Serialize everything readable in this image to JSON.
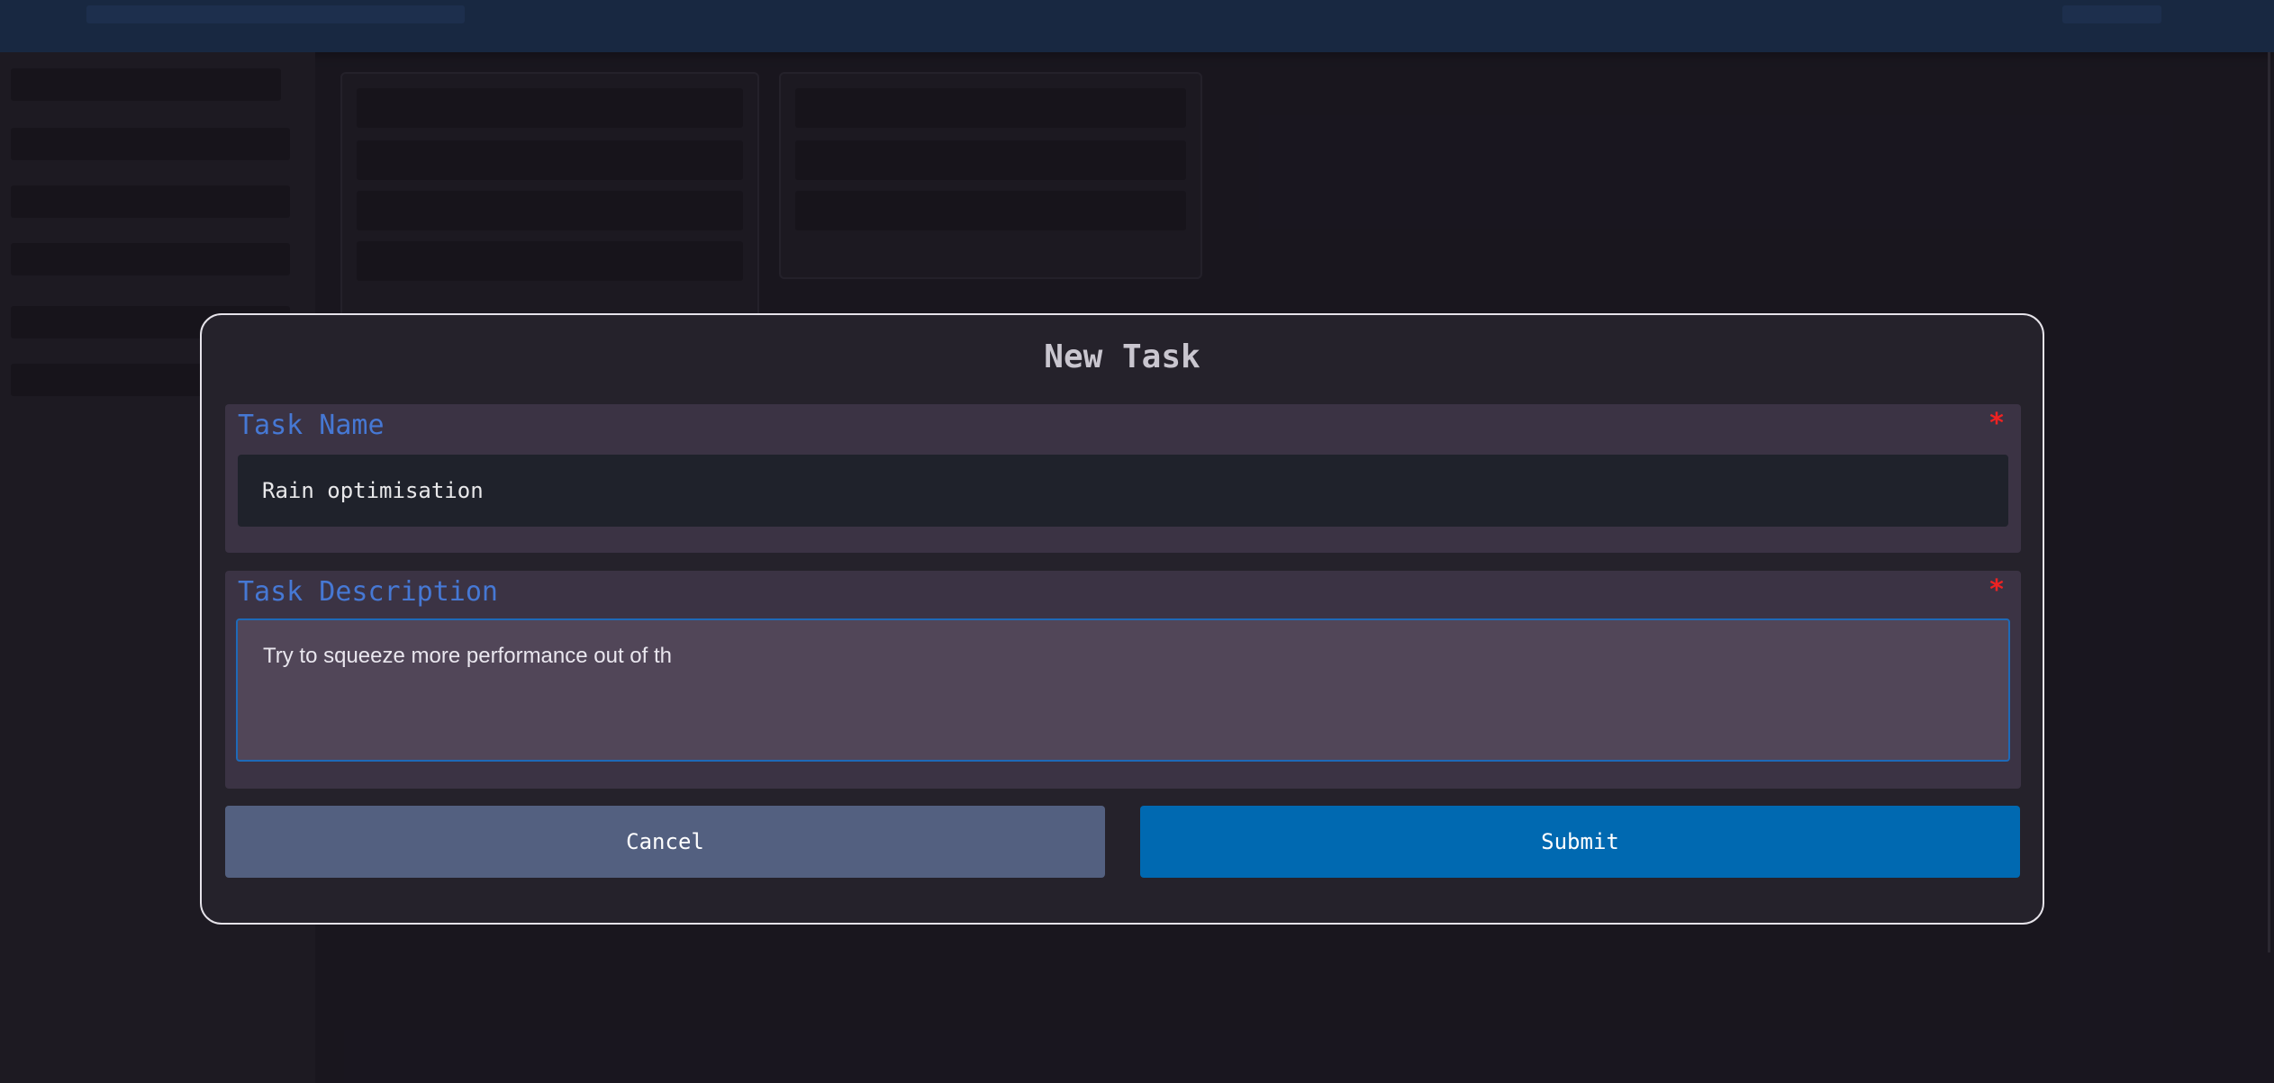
{
  "modal": {
    "title": "New Task",
    "task_name": {
      "label": "Task Name",
      "required_mark": "*",
      "value": "Rain optimisation"
    },
    "task_description": {
      "label": "Task Description",
      "required_mark": "*",
      "value": "Try to squeeze more performance out of th"
    },
    "buttons": {
      "cancel_label": "Cancel",
      "submit_label": "Submit"
    }
  },
  "colors": {
    "accent": "#4678d4",
    "required": "#ee2222",
    "submit": "#0069b1",
    "cancel": "#536080",
    "focus_border": "#1e6ab8"
  }
}
